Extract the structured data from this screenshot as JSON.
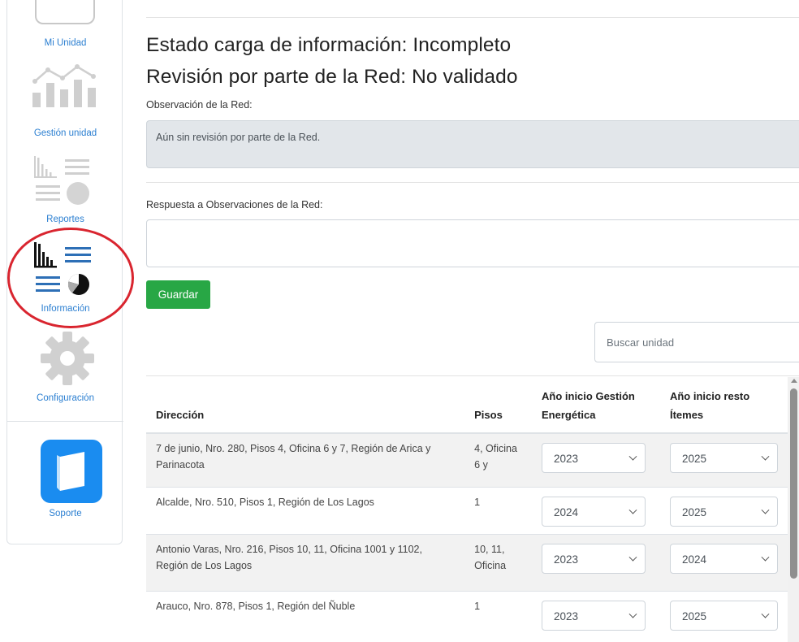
{
  "sidebar": {
    "items": [
      {
        "label": "Mi Unidad",
        "icon": "home-unit-icon"
      },
      {
        "label": "Gestión unidad",
        "icon": "line-bar-chart-icon"
      },
      {
        "label": "Reportes",
        "icon": "report-charts-icon"
      },
      {
        "label": "Información",
        "icon": "information-charts-icon"
      },
      {
        "label": "Configuración",
        "icon": "gear-icon"
      },
      {
        "label": "Soporte",
        "icon": "support-book-icon"
      }
    ],
    "highlight_color": "#d9252f",
    "link_color": "#2b7fd1"
  },
  "main": {
    "load_status": "Estado carga de información: Incompleto",
    "review_status": "Revisión por parte de la Red: No validado",
    "observation_label": "Observación de la Red:",
    "observation_text": "Aún sin revisión por parte de la Red.",
    "response_label": "Respuesta a Observaciones de la Red:",
    "response_value": "",
    "save_label": "Guardar",
    "save_color": "#28a745",
    "search_placeholder": "Buscar unidad"
  },
  "table": {
    "headers": {
      "address": "Dirección",
      "floors": "Pisos",
      "gestion_year": "Año inicio Gestión Energética",
      "resto_year": "Año inicio resto Ítemes"
    },
    "rows": [
      {
        "address": "7 de junio, Nro. 280, Pisos 4, Oficina 6 y 7, Región de Arica y Parinacota",
        "floors": "4, Oficina 6 y",
        "gestion_year": "2023",
        "resto_year": "2025"
      },
      {
        "address": "Alcalde, Nro. 510, Pisos 1, Región de Los Lagos",
        "floors": "1",
        "gestion_year": "2024",
        "resto_year": "2025"
      },
      {
        "address": "Antonio Varas, Nro. 216, Pisos 10, 11, Oficina 1001 y 1102, Región de Los Lagos",
        "floors": "10, 11, Oficina",
        "gestion_year": "2023",
        "resto_year": "2024"
      },
      {
        "address": "Arauco, Nro. 878, Pisos 1, Región del Ñuble",
        "floors": "1",
        "gestion_year": "2023",
        "resto_year": "2025"
      }
    ]
  }
}
